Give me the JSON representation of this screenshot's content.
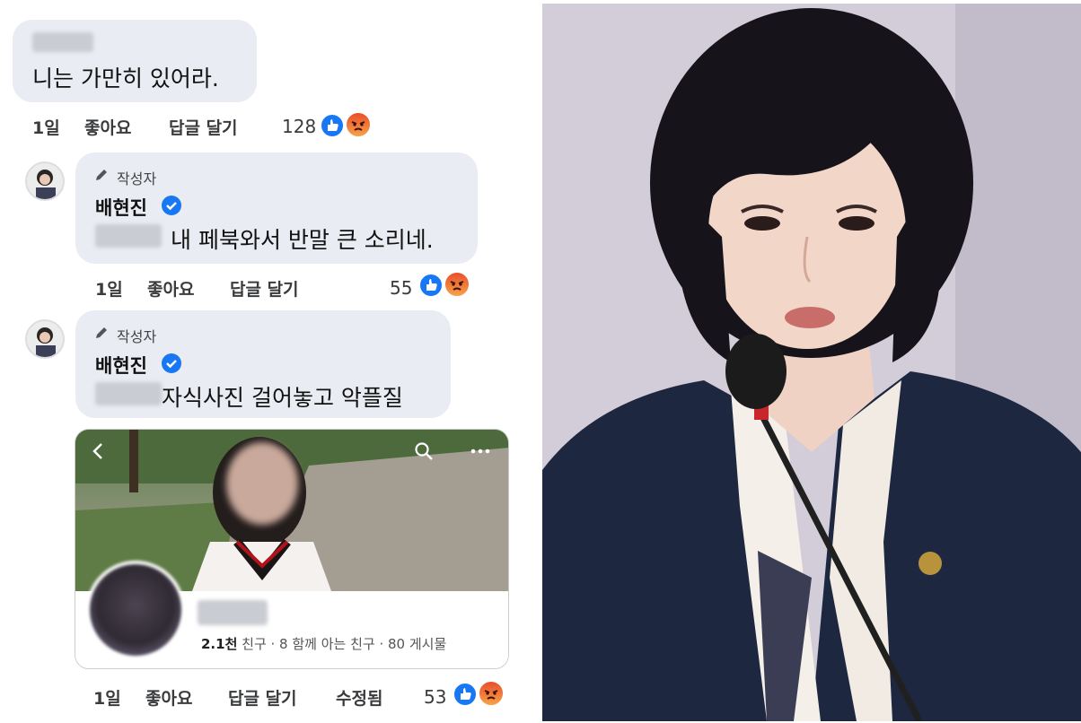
{
  "comments": [
    {
      "text": "니는 가만히 있어라.",
      "time": "1일",
      "like_label": "좋아요",
      "reply_label": "답글 달기",
      "reaction_count": "128"
    },
    {
      "author_tag": "작성자",
      "author_name": "배현진",
      "text": "내 페북와서 반말 큰 소리네.",
      "time": "1일",
      "like_label": "좋아요",
      "reply_label": "답글 달기",
      "reaction_count": "55"
    },
    {
      "author_tag": "작성자",
      "author_name": "배현진",
      "text": "자식사진 걸어놓고 악플질",
      "time": "1일",
      "like_label": "좋아요",
      "reply_label": "답글 달기",
      "edited_label": "수정됨",
      "reaction_count": "53"
    }
  ],
  "profile_card": {
    "stats_count": "2.1천",
    "stats_text": " 친구 · 8 함께 아는 친구 · 80 게시물"
  },
  "colors": {
    "bubble": "#e9ecf2",
    "like_blue": "#1877f2",
    "angry_orange": "#e94f2a",
    "jacket_navy": "#1e2740"
  },
  "icons": [
    "back-arrow-icon",
    "search-icon",
    "more-icon",
    "like-icon",
    "angry-icon",
    "verified-icon",
    "pencil-icon"
  ]
}
